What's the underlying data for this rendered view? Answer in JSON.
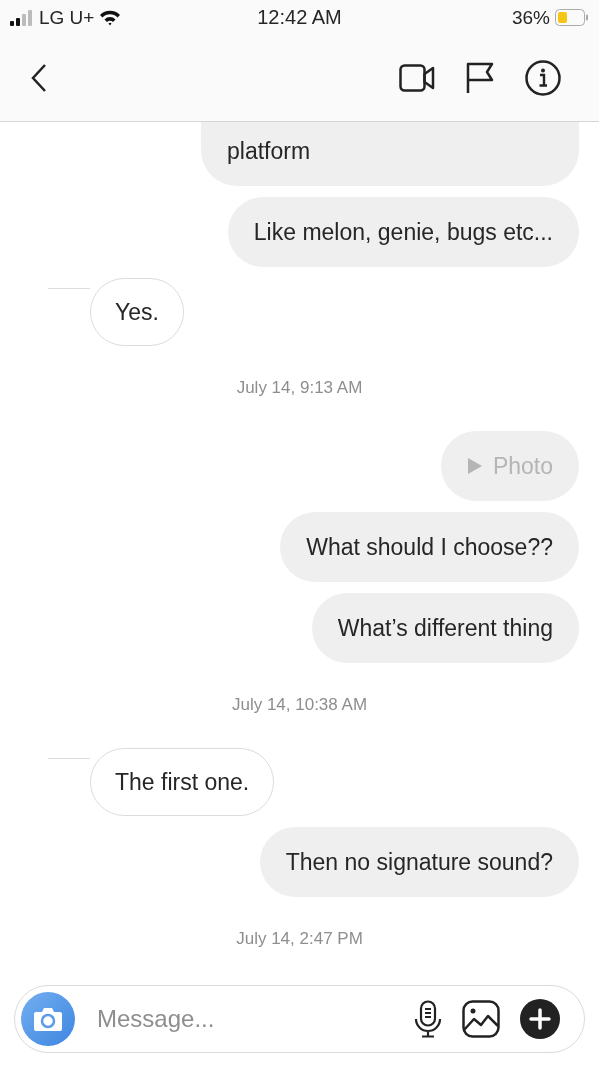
{
  "status_bar": {
    "carrier": "LG U+",
    "time": "12:42 AM",
    "battery": "36%"
  },
  "messages": [
    {
      "kind": "sent",
      "text": "platform",
      "cut": true
    },
    {
      "kind": "sent",
      "text": "Like melon, genie, bugs etc..."
    },
    {
      "kind": "received",
      "text": "Yes."
    },
    {
      "kind": "timestamp",
      "text": "July 14, 9:13 AM"
    },
    {
      "kind": "photo",
      "text": "Photo"
    },
    {
      "kind": "sent",
      "text": "What should I choose??"
    },
    {
      "kind": "sent",
      "text": "What’s different thing"
    },
    {
      "kind": "timestamp",
      "text": "July 14, 10:38 AM"
    },
    {
      "kind": "received",
      "text": "The first one."
    },
    {
      "kind": "sent",
      "text": "Then no signature sound?"
    },
    {
      "kind": "timestamp",
      "text": "July 14, 2:47 PM"
    }
  ],
  "composer": {
    "placeholder": "Message..."
  }
}
